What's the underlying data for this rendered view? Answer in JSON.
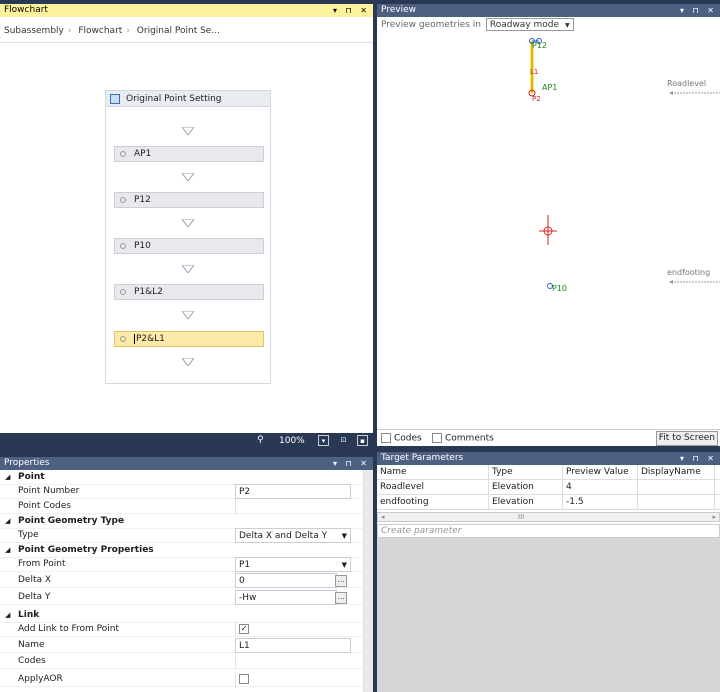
{
  "flowchart": {
    "title": "Flowchart",
    "breadcrumb": [
      "Subassembly",
      "Flowchart",
      "Original Point Se..."
    ],
    "box_title": "Original Point Setting",
    "steps": [
      "AP1",
      "P12",
      "P10",
      "P1&L2",
      "P2&L1"
    ],
    "selected_step": "P2&L1",
    "zoom": "100%"
  },
  "preview": {
    "title": "Preview",
    "label": "Preview geometries in",
    "mode": "Roadway mode",
    "codes_label": "Codes",
    "comments_label": "Comments",
    "fit_label": "Fit to Screen",
    "canvas_labels": {
      "p12": "P12",
      "l1": "L1",
      "ap1": "AP1",
      "p2": "P2",
      "p10": "P10",
      "roadlevel": "Roadlevel",
      "endfooting": "endfooting"
    }
  },
  "properties": {
    "title": "Properties",
    "rows": [
      {
        "kind": "cat",
        "label": "Point"
      },
      {
        "kind": "prop",
        "label": "Point Number",
        "value": "P2"
      },
      {
        "kind": "prop",
        "label": "Point Codes",
        "value": ""
      },
      {
        "kind": "cat",
        "label": "Point Geometry Type"
      },
      {
        "kind": "prop",
        "label": "Type",
        "value": "Delta X and Delta Y"
      },
      {
        "kind": "cat",
        "label": "Point Geometry Properties"
      },
      {
        "kind": "prop",
        "label": "From Point",
        "value": "P1"
      },
      {
        "kind": "prop",
        "label": "Delta X",
        "value": "0"
      },
      {
        "kind": "prop",
        "label": "Delta Y",
        "value": "-Hw"
      },
      {
        "kind": "cat",
        "label": "Link"
      },
      {
        "kind": "prop",
        "label": "Add Link to From Point",
        "value": "true"
      },
      {
        "kind": "prop",
        "label": "Name",
        "value": "L1"
      },
      {
        "kind": "prop",
        "label": "Codes",
        "value": ""
      },
      {
        "kind": "prop",
        "label": "ApplyAOR",
        "value": "false"
      }
    ]
  },
  "target": {
    "title": "Target Parameters",
    "columns": [
      "Name",
      "Type",
      "Preview Value",
      "DisplayName"
    ],
    "rows": [
      [
        "Roadlevel",
        "Elevation",
        "4",
        ""
      ],
      [
        "endfooting",
        "Elevation",
        "-1.5",
        ""
      ]
    ],
    "placeholder": "Create parameter"
  }
}
